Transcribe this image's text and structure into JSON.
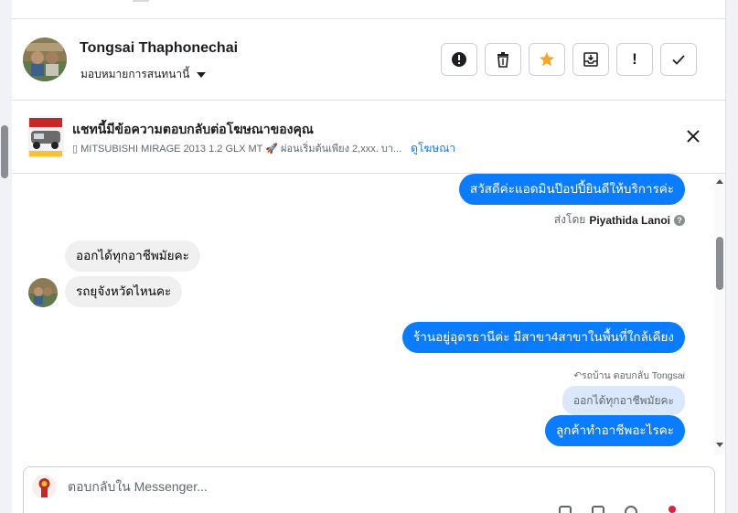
{
  "header": {
    "contact_name": "Tongsai Thaphonechai",
    "assign_label": "มอบหมายการสนทนานี้",
    "actions": [
      {
        "name": "spam-button",
        "icon": "alert-circle-icon"
      },
      {
        "name": "delete-button",
        "icon": "trash-icon"
      },
      {
        "name": "star-button",
        "icon": "star-icon",
        "color": "#f5a623"
      },
      {
        "name": "move-to-inbox-button",
        "icon": "inbox-icon"
      },
      {
        "name": "follow-up-button",
        "icon": "exclamation-icon",
        "glyph": "!"
      },
      {
        "name": "mark-done-button",
        "icon": "check-icon"
      }
    ]
  },
  "ad_banner": {
    "title": "แชทนี้มีข้อความตอบกลับต่อโฆษณาของคุณ",
    "ad_text": "▯ MITSUBISHI MIRAGE 2013 1.2 GLX MT 🚀 ผ่อนเริ่มต้นเพียง 2,xxx. บา...",
    "view_ad_link": "ดูโฆษณา"
  },
  "messages": {
    "m1": "สวัสดีค่ะแอดมินป๊อปปี้ยินดีให้บริการค่ะ",
    "sent_by_label": "ส่งโดย",
    "sent_by_name": "Piyathida Lanoi",
    "m2": "ออกได้ทุกอาชีพมัยคะ",
    "m3": "รถยุจังหวัดไหนคะ",
    "m4": "ร้านอยู่อุดรธานีค่ะ มีสาขา4สาขาในพื้นที่ใกล้เคียง",
    "reply_note": "↶รถบ้าน ตอบกลับ Tongsai",
    "quoted": "ออกได้ทุกอาชีพมัยคะ",
    "m5": "ลูกค้าทำอาชีพอะไรคะ"
  },
  "composer": {
    "placeholder": "ตอบกลับใน Messenger..."
  },
  "colors": {
    "outgoing_bubble": "#0a7cff",
    "incoming_bubble": "#f0f0f0",
    "link": "#1877f2",
    "star": "#f5a623"
  }
}
